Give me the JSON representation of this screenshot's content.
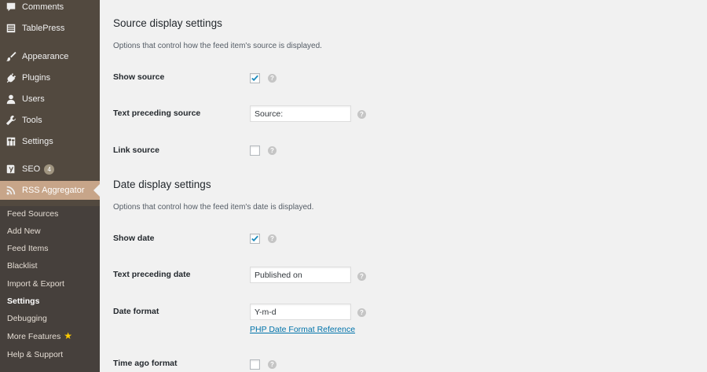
{
  "sidebar": {
    "menu": [
      {
        "label": "Comments",
        "icon": "comment-icon"
      },
      {
        "label": "TablePress",
        "icon": "table-icon"
      },
      {
        "label": "Appearance",
        "icon": "paintbrush-icon"
      },
      {
        "label": "Plugins",
        "icon": "plug-icon"
      },
      {
        "label": "Users",
        "icon": "user-icon"
      },
      {
        "label": "Tools",
        "icon": "wrench-icon"
      },
      {
        "label": "Settings",
        "icon": "settings-icon"
      },
      {
        "label": "SEO",
        "icon": "yoast-icon",
        "badge": "4"
      },
      {
        "label": "RSS Aggregator",
        "icon": "rss-icon",
        "current": true
      }
    ],
    "submenu": [
      {
        "label": "Feed Sources"
      },
      {
        "label": "Add New"
      },
      {
        "label": "Feed Items"
      },
      {
        "label": "Blacklist"
      },
      {
        "label": "Import & Export"
      },
      {
        "label": "Settings",
        "active": true
      },
      {
        "label": "Debugging"
      },
      {
        "label": "More Features",
        "icon": "star-icon"
      },
      {
        "label": "Help & Support"
      }
    ]
  },
  "main": {
    "source_section": {
      "title": "Source display settings",
      "description": "Options that control how the feed item's source is displayed.",
      "show_source_label": "Show source",
      "show_source_checked": true,
      "text_preceding_source_label": "Text preceding source",
      "text_preceding_source_value": "Source:",
      "link_source_label": "Link source",
      "link_source_checked": false
    },
    "date_section": {
      "title": "Date display settings",
      "description": "Options that control how the feed item's date is displayed.",
      "show_date_label": "Show date",
      "show_date_checked": true,
      "text_preceding_date_label": "Text preceding date",
      "text_preceding_date_value": "Published on",
      "date_format_label": "Date format",
      "date_format_value": "Y-m-d",
      "date_format_link": "PHP Date Format Reference",
      "time_ago_label": "Time ago format",
      "time_ago_checked": false
    },
    "help_glyph": "?"
  },
  "colors": {
    "sidebar_bg": "#52493f",
    "submenu_bg": "#46403c",
    "current_bg": "#c7a589",
    "link": "#0073aa",
    "page_bg": "#f1f1f1"
  }
}
